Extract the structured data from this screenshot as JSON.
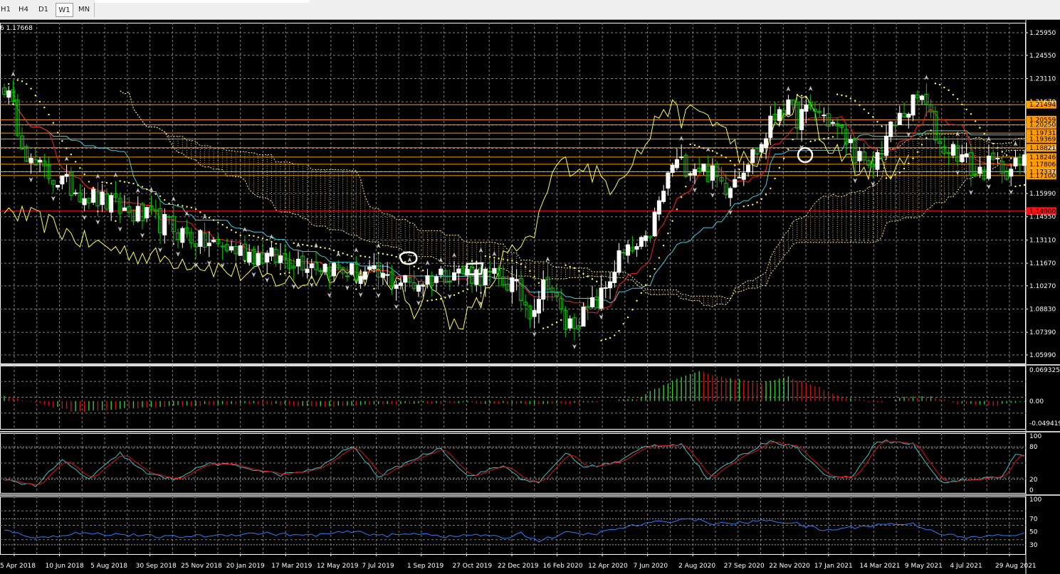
{
  "toolbar": {
    "timeframes": [
      {
        "label": "H1",
        "active": false
      },
      {
        "label": "H4",
        "active": false
      },
      {
        "label": "D1",
        "active": false
      },
      {
        "label": "W1",
        "active": true
      },
      {
        "label": "MN",
        "active": false
      }
    ]
  },
  "chart_data": {
    "type": "candlestick",
    "symbol_label": "6 1.17668",
    "timeframe": "W1",
    "colors": {
      "background": "#000000",
      "grid": "#808080",
      "bull": "#ffffff",
      "bear": "#00c800",
      "tenkan": "#ff2020",
      "kijun": "#40d0e0",
      "chikou": "#ffff40",
      "kumo": "#ffe680",
      "level_line": "#f0a020",
      "level_red": "#e02020",
      "psar": "#ffff50"
    },
    "price_axis": {
      "ylim": [
        1.0599,
        1.2595
      ],
      "ticks": [
        "1.25950",
        "1.24550",
        "1.23110",
        "1.21670",
        "1.20230",
        "1.18790",
        "1.17350",
        "1.15990",
        "1.14550",
        "1.13110",
        "1.11670",
        "1.10270",
        "1.08830",
        "1.07390",
        "1.05990"
      ]
    },
    "levels": [
      {
        "value": 1.21494,
        "label": "1.21494",
        "color": "#ff9c00"
      },
      {
        "value": 1.20559,
        "label": "1.20559",
        "color": "#ff9c00"
      },
      {
        "value": 1.2025,
        "label": "1.20250",
        "color": "#ff9c00"
      },
      {
        "value": 1.19731,
        "label": "1.19731",
        "color": "#ff9c00"
      },
      {
        "value": 1.19369,
        "label": "1.19369",
        "color": "#ff9c00"
      },
      {
        "value": 1.18821,
        "label": "1.18821",
        "color": "#ff9c00"
      },
      {
        "value": 1.18246,
        "label": "1.18246",
        "color": "#ff9c00"
      },
      {
        "value": 1.17806,
        "label": "1.17806",
        "color": "#ff9c00"
      },
      {
        "value": 1.17337,
        "label": "1.17337",
        "color": "#ff9c00"
      },
      {
        "value": 1.171,
        "label": "1.17100",
        "color": "#ff9c00"
      },
      {
        "value": 1.149,
        "label": "1.14900",
        "color": "#ff1010"
      }
    ],
    "time_labels": [
      "5 Apr 2018",
      "10 Jun 2018",
      "5 Aug 2018",
      "30 Sep 2018",
      "25 Nov 2018",
      "20 Jan 2019",
      "17 Mar 2019",
      "12 May 2019",
      "7 Jul 2019",
      "1 Sep 2019",
      "27 Oct 2019",
      "22 Dec 2019",
      "16 Feb 2020",
      "12 Apr 2020",
      "7 Jun 2020",
      "2 Aug 2020",
      "27 Sep 2020",
      "22 Nov 2020",
      "17 Jan 2021",
      "14 Mar 2021",
      "9 May 2021",
      "4 Jul 2021",
      "29 Aug 2021"
    ],
    "close_anchors": [
      [
        0,
        1.227
      ],
      [
        6,
        1.178
      ],
      [
        14,
        1.165
      ],
      [
        22,
        1.155
      ],
      [
        28,
        1.148
      ],
      [
        36,
        1.141
      ],
      [
        44,
        1.13
      ],
      [
        52,
        1.125
      ],
      [
        60,
        1.12
      ],
      [
        68,
        1.118
      ],
      [
        76,
        1.112
      ],
      [
        84,
        1.108
      ],
      [
        92,
        1.104
      ],
      [
        100,
        1.112
      ],
      [
        108,
        1.109
      ],
      [
        114,
        1.104
      ],
      [
        118,
        1.088
      ],
      [
        122,
        1.107
      ],
      [
        126,
        1.078
      ],
      [
        130,
        1.084
      ],
      [
        134,
        1.096
      ],
      [
        138,
        1.12
      ],
      [
        144,
        1.128
      ],
      [
        150,
        1.178
      ],
      [
        156,
        1.177
      ],
      [
        162,
        1.165
      ],
      [
        166,
        1.178
      ],
      [
        170,
        1.19
      ],
      [
        174,
        1.215
      ],
      [
        178,
        1.207
      ],
      [
        182,
        1.212
      ],
      [
        186,
        1.203
      ],
      [
        190,
        1.19
      ],
      [
        194,
        1.172
      ],
      [
        198,
        1.195
      ],
      [
        202,
        1.21
      ],
      [
        206,
        1.22
      ],
      [
        210,
        1.19
      ],
      [
        214,
        1.186
      ],
      [
        218,
        1.172
      ],
      [
        222,
        1.178
      ],
      [
        226,
        1.175
      ],
      [
        229,
        1.179
      ]
    ],
    "macd": {
      "label_top": "0.069325",
      "label_zero": "0.00",
      "label_bottom": "-0.049419",
      "ylim": [
        -0.049419,
        0.069325
      ],
      "anchors": [
        [
          0,
          0.012
        ],
        [
          8,
          -0.006
        ],
        [
          16,
          -0.024
        ],
        [
          26,
          -0.018
        ],
        [
          40,
          -0.01
        ],
        [
          56,
          -0.006
        ],
        [
          72,
          -0.012
        ],
        [
          86,
          -0.008
        ],
        [
          100,
          -0.004
        ],
        [
          112,
          -0.006
        ],
        [
          122,
          -0.008
        ],
        [
          132,
          -0.004
        ],
        [
          142,
          0.006
        ],
        [
          150,
          0.045
        ],
        [
          156,
          0.065
        ],
        [
          162,
          0.052
        ],
        [
          170,
          0.04
        ],
        [
          176,
          0.053
        ],
        [
          182,
          0.035
        ],
        [
          188,
          0.008
        ],
        [
          196,
          -0.004
        ],
        [
          202,
          0.008
        ],
        [
          208,
          0.01
        ],
        [
          214,
          -0.006
        ],
        [
          222,
          -0.01
        ],
        [
          229,
          -0.002
        ]
      ]
    },
    "stochastic": {
      "ticks": [
        "100",
        "80",
        "20",
        "0"
      ],
      "ylim": [
        0,
        100
      ],
      "anchors": [
        [
          0,
          20
        ],
        [
          7,
          8
        ],
        [
          13,
          55
        ],
        [
          19,
          20
        ],
        [
          26,
          68
        ],
        [
          32,
          30
        ],
        [
          38,
          20
        ],
        [
          46,
          50
        ],
        [
          54,
          42
        ],
        [
          62,
          28
        ],
        [
          70,
          38
        ],
        [
          78,
          82
        ],
        [
          84,
          25
        ],
        [
          92,
          58
        ],
        [
          98,
          78
        ],
        [
          104,
          25
        ],
        [
          112,
          45
        ],
        [
          116,
          22
        ],
        [
          120,
          12
        ],
        [
          126,
          70
        ],
        [
          130,
          42
        ],
        [
          138,
          52
        ],
        [
          144,
          82
        ],
        [
          152,
          85
        ],
        [
          158,
          20
        ],
        [
          164,
          58
        ],
        [
          172,
          92
        ],
        [
          178,
          78
        ],
        [
          184,
          28
        ],
        [
          190,
          22
        ],
        [
          196,
          92
        ],
        [
          204,
          85
        ],
        [
          210,
          15
        ],
        [
          218,
          20
        ],
        [
          224,
          25
        ],
        [
          227,
          66
        ],
        [
          229,
          62
        ]
      ]
    },
    "rsi": {
      "ticks": [
        "100",
        "70",
        "50",
        "30"
      ],
      "ylim": [
        20,
        100
      ],
      "anchors": [
        [
          0,
          52
        ],
        [
          8,
          40
        ],
        [
          16,
          48
        ],
        [
          26,
          46
        ],
        [
          36,
          42
        ],
        [
          46,
          44
        ],
        [
          58,
          48
        ],
        [
          68,
          44
        ],
        [
          78,
          50
        ],
        [
          86,
          44
        ],
        [
          94,
          48
        ],
        [
          100,
          42
        ],
        [
          106,
          46
        ],
        [
          112,
          40
        ],
        [
          116,
          48
        ],
        [
          120,
          36
        ],
        [
          126,
          48
        ],
        [
          132,
          46
        ],
        [
          140,
          58
        ],
        [
          148,
          66
        ],
        [
          154,
          70
        ],
        [
          160,
          62
        ],
        [
          166,
          64
        ],
        [
          172,
          68
        ],
        [
          178,
          62
        ],
        [
          184,
          52
        ],
        [
          192,
          58
        ],
        [
          198,
          62
        ],
        [
          204,
          62
        ],
        [
          210,
          48
        ],
        [
          216,
          40
        ],
        [
          222,
          44
        ],
        [
          229,
          46
        ]
      ]
    }
  }
}
